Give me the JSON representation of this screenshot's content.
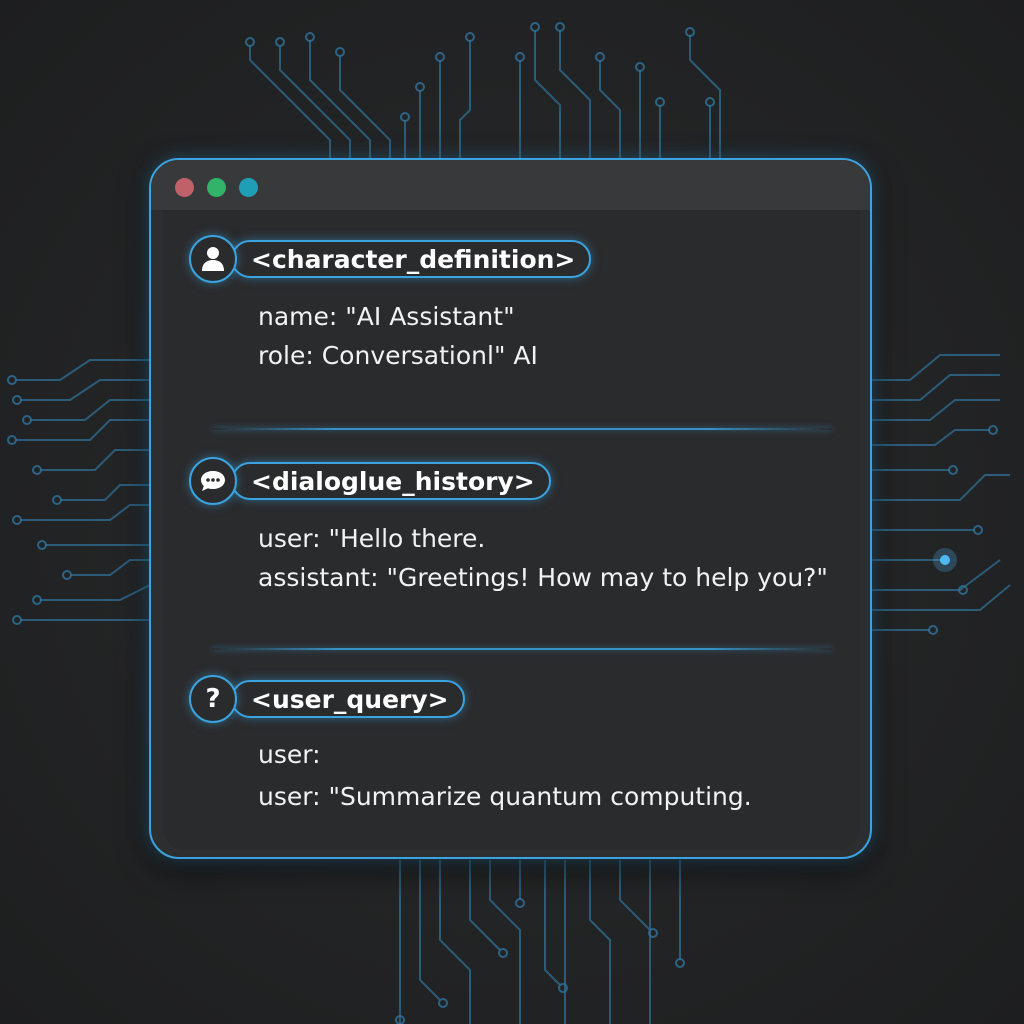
{
  "window": {
    "controls": [
      "red-dot",
      "green-dot",
      "teal-dot"
    ]
  },
  "sections": {
    "character": {
      "icon": "user-icon",
      "tag": "<character_definition>",
      "lines": [
        "name: \"AI Assistant\"",
        "role: Conversationl\" AI"
      ]
    },
    "dialogue": {
      "icon": "chat-bubble-icon",
      "tag": "<dialoglue_history>",
      "lines": [
        "user: \"Hello there.",
        "assistant: \"Greetings! How may to help you?\""
      ]
    },
    "query": {
      "icon": "question-icon",
      "tag": "<user_query>",
      "icon_glyph": "?",
      "lines": [
        "user:",
        "user: \"Summarize quantum computing."
      ]
    }
  },
  "colors": {
    "accent": "#3aa3e0",
    "window_bg": "#2d2e30",
    "background": "#232425",
    "dot_red": "#c0616a",
    "dot_green": "#31b36a",
    "dot_teal": "#1f9fb6"
  }
}
